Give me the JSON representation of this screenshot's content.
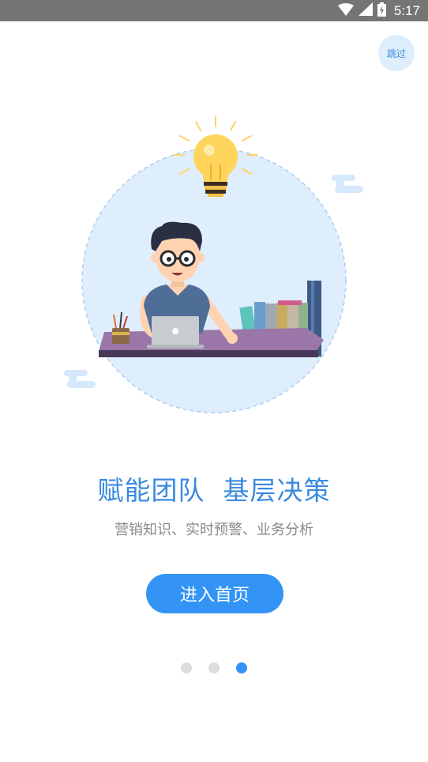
{
  "status_bar": {
    "time": "5:17",
    "icons": [
      "wifi-icon",
      "cell-signal-icon",
      "battery-charging-icon"
    ]
  },
  "skip": {
    "label": "跳过"
  },
  "illustration": {
    "subject": "person-with-laptop-and-lightbulb"
  },
  "content": {
    "headline": "赋能团队  基层决策",
    "subline": "营销知识、实时预警、业务分析"
  },
  "enter": {
    "label": "进入首页"
  },
  "pager": {
    "count": 3,
    "active_index": 2
  },
  "colors": {
    "accent": "#3394f5",
    "headline": "#3a8ae0",
    "subline": "#8a8a8a",
    "status_bar": "#757575"
  }
}
